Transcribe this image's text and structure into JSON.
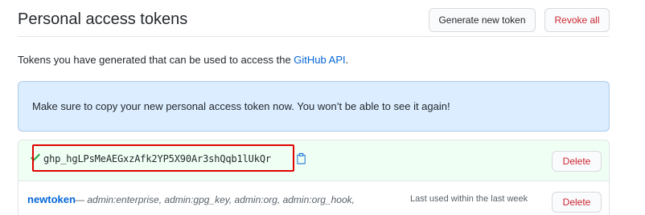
{
  "header": {
    "title": "Personal access tokens",
    "generate_label": "Generate new token",
    "revoke_label": "Revoke all"
  },
  "intro": {
    "text": "Tokens you have generated that can be used to access the ",
    "link": "GitHub API",
    "suffix": "."
  },
  "flash": {
    "message": "Make sure to copy your new personal access token now. You won’t be able to see it again!"
  },
  "new_token": {
    "value": "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",
    "delete_label": "Delete"
  },
  "tokens": [
    {
      "name": "newtoken",
      "dash": " — ",
      "scopes": "admin:enterprise, admin:gpg_key, admin:org, admin:org_hook,",
      "last_used": "Last used within the last week",
      "delete_label": "Delete"
    }
  ],
  "colors": {
    "accent": "#0366d6",
    "danger": "#cb2431",
    "success": "#28a745",
    "flash_bg": "#dbedff",
    "highlight": "#e00000"
  },
  "icons": {
    "check": "check-icon",
    "copy": "clippy-icon"
  }
}
